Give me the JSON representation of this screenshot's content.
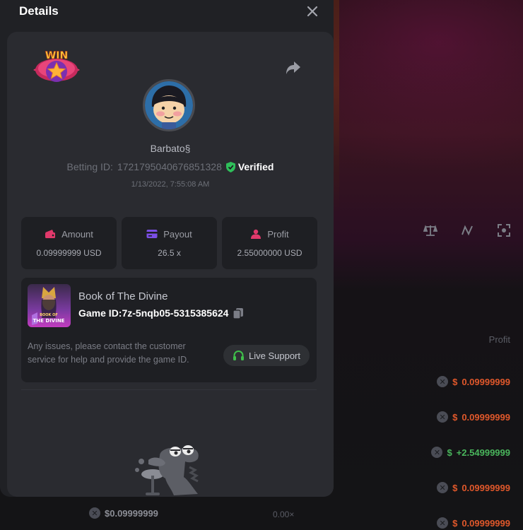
{
  "modal": {
    "title": "Details",
    "username": "Barbato§",
    "betting_id_label": "Betting ID:",
    "betting_id": "1721795040676851328",
    "verified_label": "Verified",
    "timestamp": "1/13/2022, 7:55:08 AM",
    "badge": "WIN",
    "stats": [
      {
        "label": "Amount",
        "value": "0.09999999 USD",
        "icon": "wallet-icon"
      },
      {
        "label": "Payout",
        "value": "26.5 x",
        "icon": "card-icon"
      },
      {
        "label": "Profit",
        "value": "2.55000000 USD",
        "icon": "user-icon"
      }
    ],
    "game": {
      "name": "Book of The Divine",
      "id_label": "Game ID:",
      "id": "7z-5nqb05-5315385624",
      "thumb_text": "BOOK OF THE DIVINE"
    },
    "help_text": "Any issues, please contact the customer service for help and provide the game ID.",
    "live_support_label": "Live Support"
  },
  "background": {
    "profile_header": "Profit",
    "rows": [
      {
        "currency": "$",
        "value": "0.09999999",
        "status": "loss"
      },
      {
        "currency": "$",
        "value": "0.09999999",
        "status": "loss"
      },
      {
        "currency": "$",
        "value": "+2.54999999",
        "status": "win"
      },
      {
        "currency": "$",
        "value": "0.09999999",
        "status": "loss"
      },
      {
        "currency": "$",
        "value": "0.09999999",
        "status": "loss"
      }
    ],
    "bottom_amount": "$0.09999999",
    "bottom_multiplier": "0.00×"
  },
  "colors": {
    "loss": "#e0582b",
    "win": "#49b65c",
    "verified": "#2fbf5a",
    "accent_pink": "#e0396b",
    "accent_purple": "#7b4ee6"
  }
}
